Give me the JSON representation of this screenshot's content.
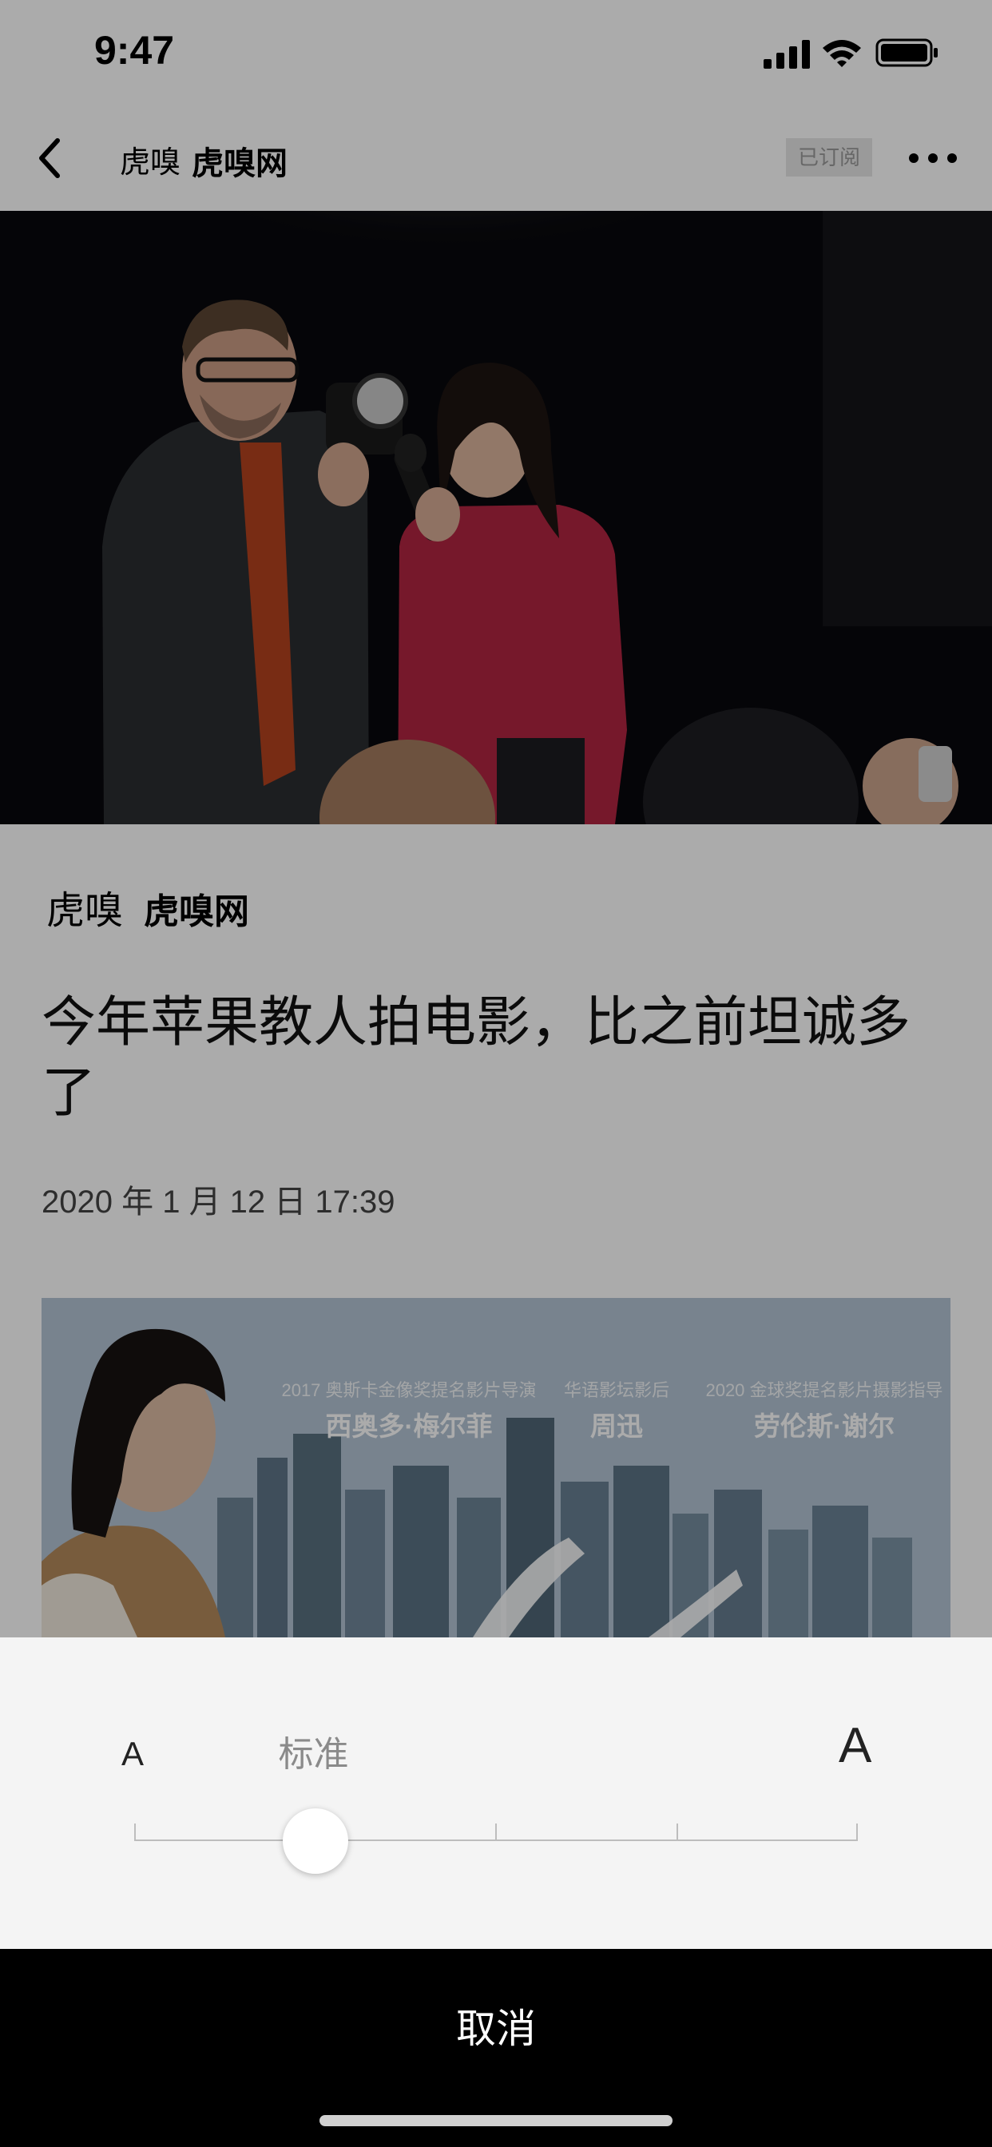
{
  "status_bar": {
    "time": "9:47"
  },
  "nav": {
    "logo_text": "虎嗅",
    "title": "虎嗅网",
    "subscribed_label": "已订阅"
  },
  "article": {
    "source_logo": "虎嗅",
    "source_name": "虎嗅网",
    "title": "今年苹果教人拍电影，比之前坦诚多了",
    "date": "2020 年 1 月 12 日 17:39",
    "inline_image": {
      "credits": [
        {
          "role": "2017 奥斯卡金像奖提名影片导演",
          "name": "西奥多·梅尔菲"
        },
        {
          "role": "华语影坛影后",
          "name": "周迅"
        },
        {
          "role": "2020 金球奖提名影片摄影指导",
          "name": "劳伦斯·谢尔"
        }
      ]
    }
  },
  "font_sheet": {
    "small_a": "A",
    "current_label": "标准",
    "large_a": "A",
    "level_index": 1,
    "level_count": 5
  },
  "cancel_label": "取消",
  "colors": {
    "overlay": "rgba(0,0,0,0.33)",
    "sheet_bg": "#f4f4f4",
    "cancel_bar": "#000000"
  }
}
